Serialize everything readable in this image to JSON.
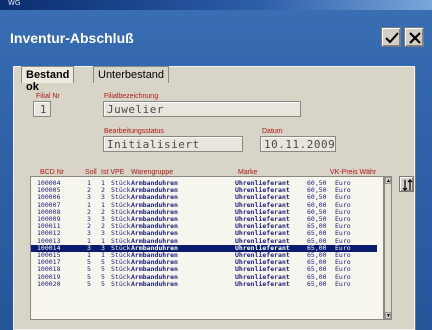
{
  "window": {
    "titlebar_text": "WG"
  },
  "app": {
    "title": "Inventur-Abschluß"
  },
  "tabs": [
    {
      "label": "Bestand ok",
      "active": true
    },
    {
      "label": "Unterbestand",
      "active": false
    }
  ],
  "fields": {
    "filial_nr": {
      "label": "Filial Nr",
      "value": "1"
    },
    "filialbezeichnung": {
      "label": "Filialbezeichnung",
      "value": "Juwelier"
    },
    "bearbeitungsstatus": {
      "label": "Bearbeitungsstatus",
      "value": "Initialisiert"
    },
    "datum": {
      "label": "Datum",
      "value": "10.11.2009"
    }
  },
  "list": {
    "columns": [
      "BCD Nr",
      "Soll",
      "Ist VPE",
      "Warengruppe",
      "Marke",
      "VK-Preis Währ"
    ],
    "selected_index": 9,
    "rows": [
      {
        "bcd": "100004",
        "soll": "1",
        "ist": "1",
        "unit": "Stück",
        "gruppe": "Armbanduhren",
        "marke": "Uhrenlieferant",
        "preis": "60,50",
        "waehr": "Euro"
      },
      {
        "bcd": "100005",
        "soll": "2",
        "ist": "2",
        "unit": "Stück",
        "gruppe": "Armbanduhren",
        "marke": "Uhrenlieferant",
        "preis": "60,50",
        "waehr": "Euro"
      },
      {
        "bcd": "100006",
        "soll": "3",
        "ist": "3",
        "unit": "Stück",
        "gruppe": "Armbanduhren",
        "marke": "Uhrenlieferant",
        "preis": "60,50",
        "waehr": "Euro"
      },
      {
        "bcd": "100007",
        "soll": "1",
        "ist": "1",
        "unit": "Stück",
        "gruppe": "Armbanduhren",
        "marke": "Uhrenlieferant",
        "preis": "60,00",
        "waehr": "Euro"
      },
      {
        "bcd": "100008",
        "soll": "2",
        "ist": "2",
        "unit": "Stück",
        "gruppe": "Armbanduhren",
        "marke": "Uhrenlieferant",
        "preis": "60,50",
        "waehr": "Euro"
      },
      {
        "bcd": "100009",
        "soll": "3",
        "ist": "3",
        "unit": "Stück",
        "gruppe": "Armbanduhren",
        "marke": "Uhrenlieferant",
        "preis": "60,50",
        "waehr": "Euro"
      },
      {
        "bcd": "100011",
        "soll": "2",
        "ist": "2",
        "unit": "Stück",
        "gruppe": "Armbanduhren",
        "marke": "Uhrenlieferant",
        "preis": "65,00",
        "waehr": "Euro"
      },
      {
        "bcd": "100012",
        "soll": "3",
        "ist": "3",
        "unit": "Stück",
        "gruppe": "Armbanduhren",
        "marke": "Uhrenlieferant",
        "preis": "65,00",
        "waehr": "Euro"
      },
      {
        "bcd": "100013",
        "soll": "1",
        "ist": "1",
        "unit": "Stück",
        "gruppe": "Armbanduhren",
        "marke": "Uhrenlieferant",
        "preis": "65,00",
        "waehr": "Euro"
      },
      {
        "bcd": "100014",
        "soll": "3",
        "ist": "3",
        "unit": "Stück",
        "gruppe": "Armbanduhren",
        "marke": "Uhrenlieferant",
        "preis": "65,00",
        "waehr": "Euro"
      },
      {
        "bcd": "100015",
        "soll": "1",
        "ist": "1",
        "unit": "Stück",
        "gruppe": "Armbanduhren",
        "marke": "Uhrenlieferant",
        "preis": "65,00",
        "waehr": "Euro"
      },
      {
        "bcd": "100017",
        "soll": "5",
        "ist": "5",
        "unit": "Stück",
        "gruppe": "Armbanduhren",
        "marke": "Uhrenlieferant",
        "preis": "65,00",
        "waehr": "Euro"
      },
      {
        "bcd": "100018",
        "soll": "5",
        "ist": "5",
        "unit": "Stück",
        "gruppe": "Armbanduhren",
        "marke": "Uhrenlieferant",
        "preis": "65,00",
        "waehr": "Euro"
      },
      {
        "bcd": "100019",
        "soll": "5",
        "ist": "5",
        "unit": "Stück",
        "gruppe": "Armbanduhren",
        "marke": "Uhrenlieferant",
        "preis": "65,00",
        "waehr": "Euro"
      },
      {
        "bcd": "100020",
        "soll": "5",
        "ist": "5",
        "unit": "Stück",
        "gruppe": "Armbanduhren",
        "marke": "Uhrenlieferant",
        "preis": "65,00",
        "waehr": "Euro"
      }
    ]
  },
  "icons": {
    "ok": "checkmark-icon",
    "close": "close-icon",
    "sort": "sort-icon",
    "scroll_up": "arrow-up-icon",
    "scroll_down": "arrow-down-icon"
  },
  "colors": {
    "label_red": "#b01818",
    "selection_blue": "#0a1c6e",
    "row_text": "#1c1c7a"
  }
}
